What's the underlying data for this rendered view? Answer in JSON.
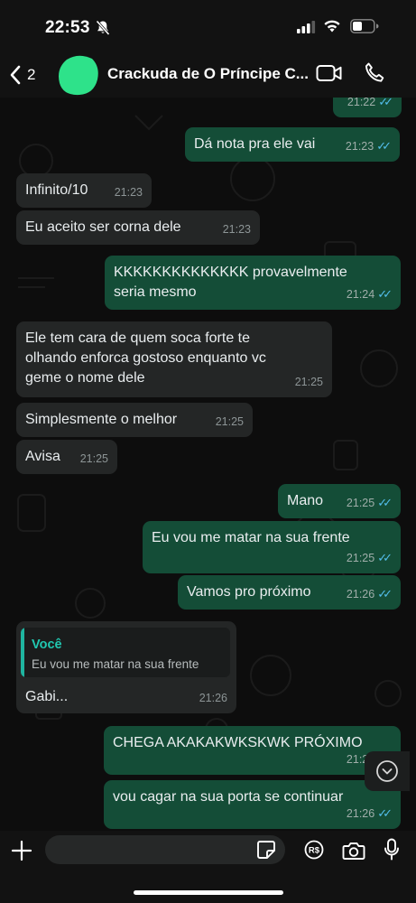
{
  "status_bar": {
    "time": "22:53"
  },
  "header": {
    "back_count": "2",
    "chat_title": "Crackuda de O Príncipe C..."
  },
  "messages": [
    {
      "dir": "out",
      "text": "",
      "time": "21:22",
      "read": true
    },
    {
      "dir": "out",
      "text": "Dá nota pra ele vai",
      "time": "21:23",
      "read": true
    },
    {
      "dir": "in",
      "text": "Infinito/10",
      "time": "21:23"
    },
    {
      "dir": "in",
      "text": "Eu aceito ser corna dele",
      "time": "21:23"
    },
    {
      "dir": "out",
      "text": "KKKKKKKKKKKKKK provavelmente\nseria mesmo",
      "time": "21:24",
      "read": true
    },
    {
      "dir": "in",
      "text": "Ele tem cara de quem soca forte te\nolhando enforca gostoso enquanto vc\ngeme o nome dele",
      "time": "21:25"
    },
    {
      "dir": "in",
      "text": "Simplesmente o melhor",
      "time": "21:25"
    },
    {
      "dir": "in",
      "text": "Avisa",
      "time": "21:25"
    },
    {
      "dir": "out",
      "text": "Mano",
      "time": "21:25",
      "read": true
    },
    {
      "dir": "out",
      "text": "Eu vou me matar na sua frente",
      "time": "21:25",
      "read": true
    },
    {
      "dir": "out",
      "text": "Vamos pro próximo",
      "time": "21:26",
      "read": true
    },
    {
      "dir": "in",
      "text": "Gabi...",
      "time": "21:26",
      "quote": {
        "author": "Você",
        "text": "Eu vou me matar na sua frente"
      }
    },
    {
      "dir": "out",
      "text": "CHEGA AKAKAKWKSKWK PRÓXIMO",
      "time": "21:26",
      "read": true
    },
    {
      "dir": "out",
      "text": "vou cagar na sua porta se continuar",
      "time": "21:26",
      "read": true
    }
  ],
  "input": {
    "placeholder": "",
    "value": ""
  },
  "colors": {
    "outgoing_bubble": "#144d37",
    "incoming_bubble": "#242626",
    "read_ticks": "#53bdeb",
    "quote_accent": "#1fb5a0",
    "background": "#0b0b0b"
  },
  "icons": [
    "bell-slash-icon",
    "signal-icon",
    "wifi-icon",
    "battery-icon",
    "back-chevron-icon",
    "video-call-icon",
    "voice-call-icon",
    "double-check-icon",
    "chevron-down-icon",
    "plus-icon",
    "sticker-icon",
    "payment-icon",
    "camera-icon",
    "microphone-icon"
  ]
}
